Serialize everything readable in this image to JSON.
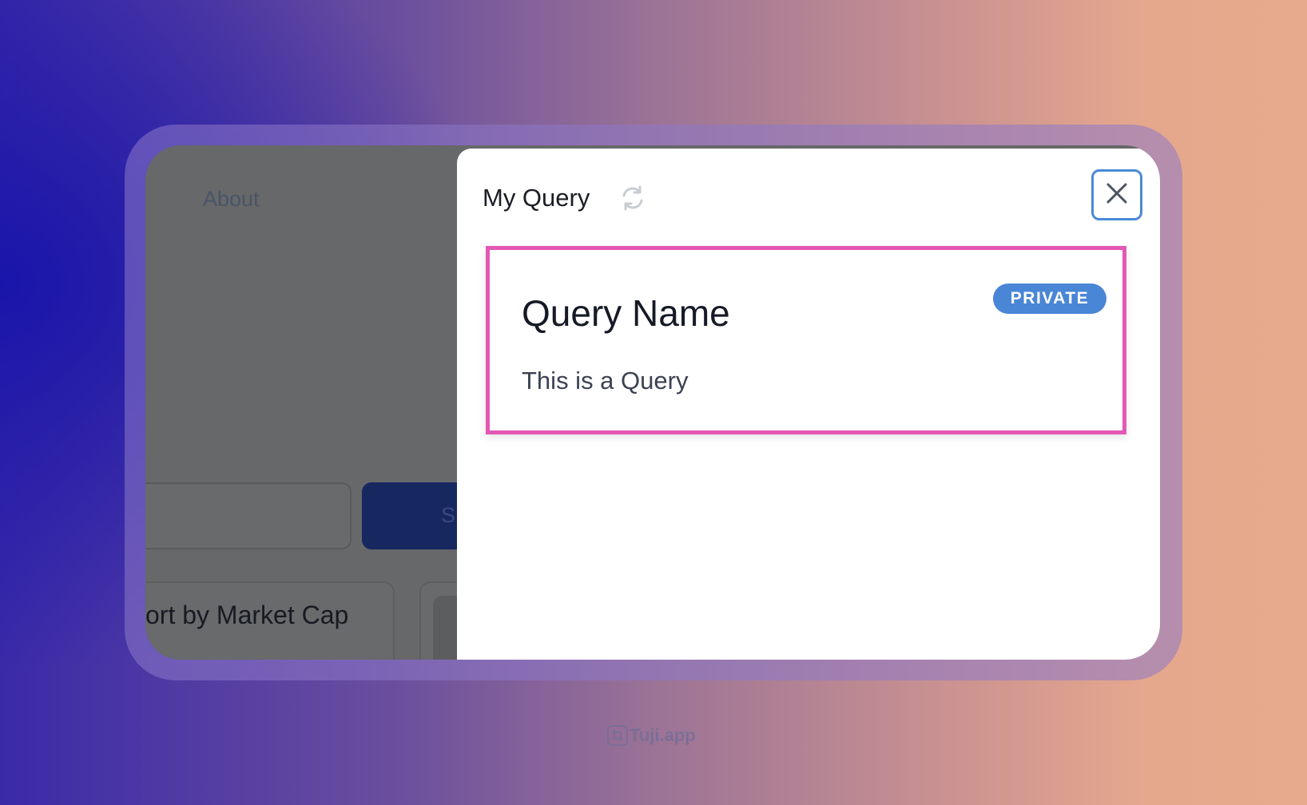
{
  "background_app": {
    "nav_about": "About",
    "search_button_label": "S",
    "sort_label": "ort by Market Cap"
  },
  "panel": {
    "title": "My Query",
    "refresh_icon": "refresh-icon",
    "close_icon": "close-icon"
  },
  "query_card": {
    "name": "Query Name",
    "description": "This is a Query",
    "badge": "PRIVATE",
    "badge_color": "#4a86d6",
    "highlight_color": "#e458b4"
  },
  "watermark": {
    "text": "Tuji.app"
  }
}
